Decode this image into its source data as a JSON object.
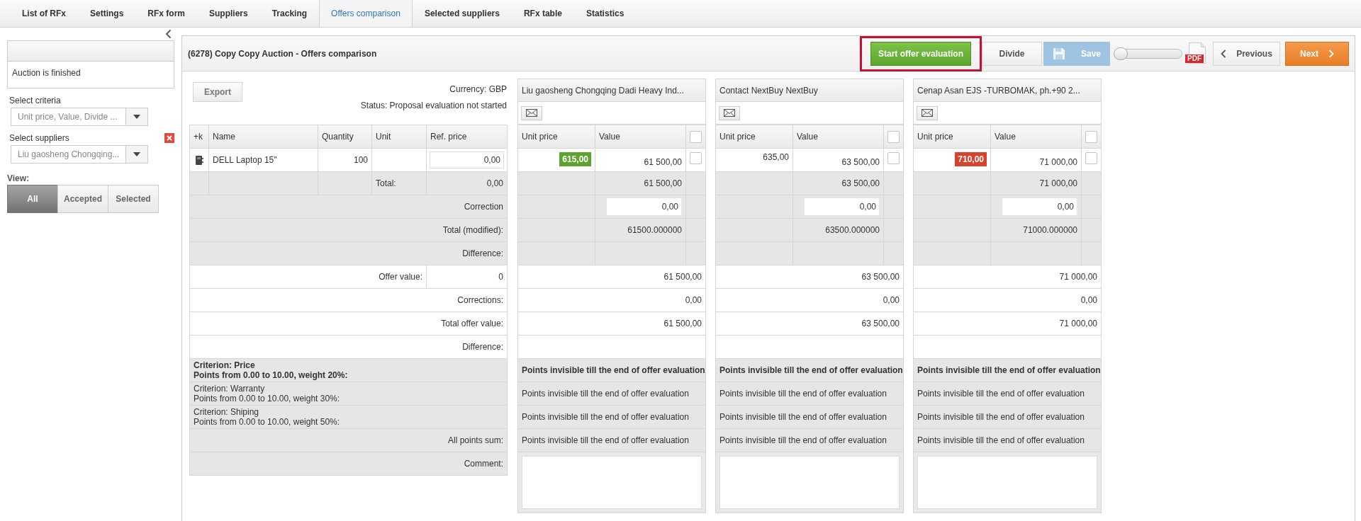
{
  "tabs": [
    {
      "label": "List of RFx",
      "selected": false
    },
    {
      "label": "Settings",
      "selected": false
    },
    {
      "label": "RFx form",
      "selected": false
    },
    {
      "label": "Suppliers",
      "selected": false
    },
    {
      "label": "Tracking",
      "selected": false
    },
    {
      "label": "Offers comparison",
      "selected": true
    },
    {
      "label": "Selected suppliers",
      "selected": false
    },
    {
      "label": "RFx table",
      "selected": false
    },
    {
      "label": "Statistics",
      "selected": false
    }
  ],
  "sidebar": {
    "status_text": "Auction is finished",
    "criteria": {
      "label": "Select criteria",
      "value": "Unit price, Value, Divide ..."
    },
    "suppliers": {
      "label": "Select suppliers",
      "value": "Liu gaosheng Chongqing..."
    },
    "view": {
      "label": "View:",
      "options": [
        {
          "label": "All",
          "selected": true
        },
        {
          "label": "Accepted",
          "selected": false
        },
        {
          "label": "Selected",
          "selected": false
        }
      ]
    }
  },
  "panel": {
    "title": "(6278) Copy Copy Auction - Offers comparison",
    "buttons": [
      {
        "label": "Start offer evaluation",
        "kind": "primary",
        "disabled": false,
        "highlighted": true
      },
      {
        "label": "Divide",
        "kind": "default",
        "disabled": false,
        "highlighted": false
      },
      {
        "label": "Save",
        "kind": "save",
        "disabled": true,
        "highlighted": false
      }
    ],
    "slider": {
      "level": 0
    },
    "pdf_label": "PDF",
    "nav": [
      {
        "label": "Previous",
        "kind": "previous"
      },
      {
        "label": "Next",
        "kind": "next"
      }
    ]
  },
  "comparison": {
    "export_label": "Export",
    "currency": "Currency: GBP",
    "status": "Status: Proposal evaluation not started",
    "columns": [
      "+k",
      "Name",
      "Quantity",
      "Unit",
      "Ref. price"
    ],
    "items": [
      {
        "name": "DELL Laptop 15\"",
        "quantity": "100",
        "ref_price": "0,00"
      }
    ],
    "total_label": "Total:",
    "total": "0,00",
    "adjust_labels": [
      "Correction",
      "Total (modified):",
      "Difference:"
    ],
    "offer_label": "Offer value:",
    "offer_value": "0",
    "offer_labels": [
      "Corrections:",
      "Total offer value:",
      "Difference:"
    ],
    "criteria": [
      {
        "name": "Criterion: Price",
        "detail": "Points from 0.00 to 10.00, weight 20%:",
        "active": true
      },
      {
        "name": "Criterion: Warranty",
        "detail": "Points from 0.00 to 10.00, weight 30%:",
        "active": false
      },
      {
        "name": "Criterion: Shiping",
        "detail": "Points from 0.00 to 10.00, weight 50%:",
        "active": false
      }
    ],
    "points_sum_label": "All points sum:",
    "comment_label": "Comment:"
  },
  "suppliers": [
    {
      "name": "Liu gaosheng Chongqing Dadi Heavy Ind...",
      "columns": [
        "Unit price",
        "Value"
      ],
      "all_checked": false,
      "unit_price": "615,00",
      "color": "#5ca22c",
      "value": "61 500,00",
      "checked": false,
      "total": "61 500,00",
      "correction": "0,00",
      "total_modified": "61500.000000",
      "offer_value": "61 500,00",
      "corrections": "0,00",
      "total_offer_value": "61 500,00",
      "points": [
        {
          "text": "Points invisible till the end of offer evaluation",
          "active": true
        },
        {
          "text": "Points invisible till the end of offer evaluation",
          "active": false
        },
        {
          "text": "Points invisible till the end of offer evaluation",
          "active": false
        },
        {
          "text": "Points invisible till the end of offer evaluation",
          "active": false
        }
      ]
    },
    {
      "name": "Contact NextBuy NextBuy",
      "columns": [
        "Unit price",
        "Value"
      ],
      "all_checked": false,
      "unit_price": "635,00",
      "value": "63 500,00",
      "checked": false,
      "total": "63 500,00",
      "correction": "0,00",
      "total_modified": "63500.000000",
      "offer_value": "63 500,00",
      "corrections": "0,00",
      "total_offer_value": "63 500,00",
      "points": [
        {
          "text": "Points invisible till the end of offer evaluation",
          "active": true
        },
        {
          "text": "Points invisible till the end of offer evaluation",
          "active": false
        },
        {
          "text": "Points invisible till the end of offer evaluation",
          "active": false
        },
        {
          "text": "Points invisible till the end of offer evaluation",
          "active": false
        }
      ]
    },
    {
      "name": "Cenap Asan EJS -TURBOMAK, ph.+90 2...",
      "columns": [
        "Unit price",
        "Value"
      ],
      "all_checked": false,
      "unit_price": "710,00",
      "color": "#d8412c",
      "value": "71 000,00",
      "checked": false,
      "total": "71 000,00",
      "correction": "0,00",
      "total_modified": "71000.000000",
      "offer_value": "71 000,00",
      "corrections": "0,00",
      "total_offer_value": "71 000,00",
      "points": [
        {
          "text": "Points invisible till the end of offer evaluation",
          "active": true
        },
        {
          "text": "Points invisible till the end of offer evaluation",
          "active": false
        },
        {
          "text": "Points invisible till the end of offer evaluation",
          "active": false
        },
        {
          "text": "Points invisible till the end of offer evaluation",
          "active": false
        }
      ]
    }
  ]
}
